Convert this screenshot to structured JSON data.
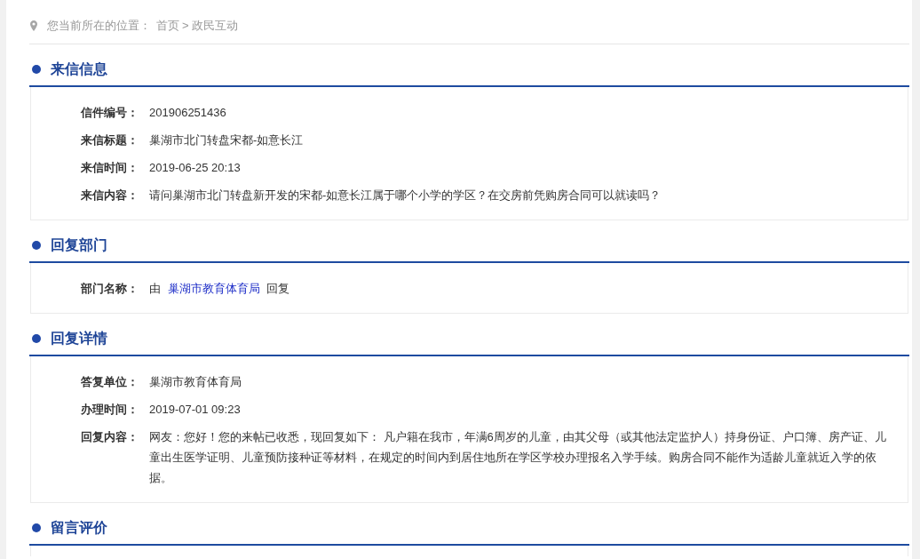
{
  "breadcrumb": {
    "label": "您当前所在的位置：",
    "separator": ">",
    "path": [
      "首页",
      "政民互动"
    ]
  },
  "sections": [
    {
      "title": "来信信息",
      "rows": [
        {
          "kind": "text",
          "label": "信件编号：",
          "value": "201906251436"
        },
        {
          "kind": "text",
          "label": "来信标题：",
          "value": "巢湖市北门转盘宋都-如意长江"
        },
        {
          "kind": "text",
          "label": "来信时间：",
          "value": "2019-06-25 20:13"
        },
        {
          "kind": "text",
          "label": "来信内容：",
          "value": "请问巢湖市北门转盘新开发的宋都-如意长江属于哪个小学的学区？在交房前凭购房合同可以就读吗？"
        }
      ]
    },
    {
      "title": "回复部门",
      "rows": [
        {
          "kind": "department",
          "label": "部门名称：",
          "prefix": "由",
          "link": "巢湖市教育体育局",
          "suffix": "回复"
        }
      ]
    },
    {
      "title": "回复详情",
      "rows": [
        {
          "kind": "text",
          "label": "答复单位：",
          "value": "巢湖市教育体育局"
        },
        {
          "kind": "text",
          "label": "办理时间：",
          "value": "2019-07-01 09:23"
        },
        {
          "kind": "text",
          "label": "回复内容：",
          "value": "网友：您好！您的来帖已收悉，现回复如下： 凡户籍在我市，年满6周岁的儿童，由其父母（或其他法定监护人）持身份证、户口簿、房产证、儿童出生医学证明、儿童预防接种证等材料，在规定的时间内到居住地所在学区学校办理报名入学手续。购房合同不能作为适龄儿童就近入学的依据。"
        }
      ]
    },
    {
      "title": "留言评价"
    }
  ]
}
